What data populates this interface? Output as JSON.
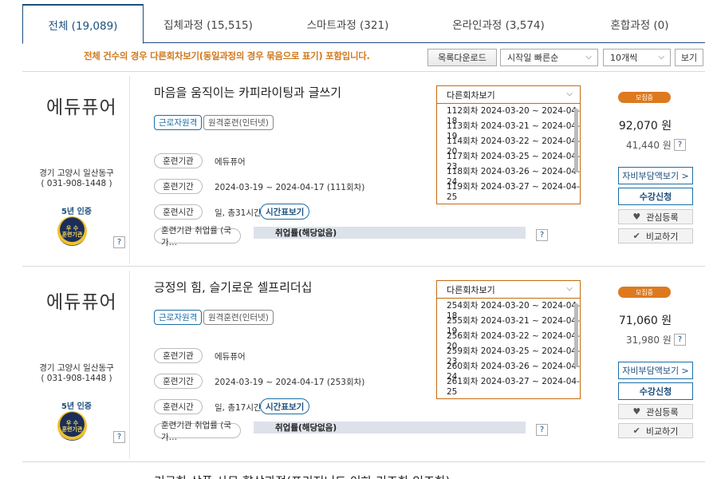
{
  "tabs": [
    {
      "label": "전체 (19,089)"
    },
    {
      "label": "집체과정 (15,515)"
    },
    {
      "label": "스마트과정 (321)"
    },
    {
      "label": "온라인과정 (3,574)"
    },
    {
      "label": "혼합과정 (0)"
    }
  ],
  "toolbar": {
    "notice": "전체 건수의 경우 다른회차보기(동일과정의 경우 묶음으로 표기) 포함입니다.",
    "download_label": "목록다운로드",
    "sort_value": "시작일 빠른순",
    "count_value": "10개씩",
    "view_label": "보기"
  },
  "labels": {
    "org": "훈련기관",
    "period": "훈련기간",
    "time": "훈련시간",
    "employment": "훈련기관 취업률 (국가…",
    "timetable": "시간표보기",
    "other_sessions": "다른회차보기",
    "recruiting": "모집중",
    "self_pay": "자비부담액보기 >",
    "apply": "수강신청",
    "favorite": "관심등록",
    "compare": "비교하기",
    "cert_years": "5년 인증",
    "badge_line1": "우 수",
    "badge_line2": "훈련기관",
    "question": "?"
  },
  "courses": [
    {
      "org_logo": "에듀퓨어",
      "address": "경기 고양시 일산동구",
      "phone": "( 031-908-1448 )",
      "title": "마음을 움직이는 카피라이팅과 글쓰기",
      "tag1": "근로자원격",
      "tag2": "원격훈련(인터넷)",
      "org_name": "에듀퓨어",
      "period": "2024-03-19 ~ 2024-04-17 (111회차)",
      "hours": "일, 총31시간",
      "employment": "취업률(해당없음)",
      "price": "92,070 원",
      "self_price": "41,440 원",
      "sessions": [
        "112회차 2024-03-20 ~ 2024-04-18",
        "113회차 2024-03-21 ~ 2024-04-19",
        "114회차 2024-03-22 ~ 2024-04-20",
        "117회차 2024-03-25 ~ 2024-04-23",
        "118회차 2024-03-26 ~ 2024-04-24",
        "119회차 2024-03-27 ~ 2024-04-25"
      ]
    },
    {
      "org_logo": "에듀퓨어",
      "address": "경기 고양시 일산동구",
      "phone": "( 031-908-1448 )",
      "title": "긍정의 힘, 슬기로운 셀프리더십",
      "tag1": "근로자원격",
      "tag2": "원격훈련(인터넷)",
      "org_name": "에듀퓨어",
      "period": "2024-03-19 ~ 2024-04-17 (253회차)",
      "hours": "일, 총17시간",
      "employment": "취업률(해당없음)",
      "price": "71,060 원",
      "self_price": "31,980 원",
      "sessions": [
        "254회차 2024-03-20 ~ 2024-04-18",
        "255회차 2024-03-21 ~ 2024-04-19",
        "256회차 2024-03-22 ~ 2024-04-20",
        "259회차 2024-03-25 ~ 2024-04-23",
        "260회차 2024-03-26 ~ 2024-04-24",
        "261회차 2024-03-27 ~ 2024-04-25"
      ]
    }
  ],
  "next_course_partial_title": "기근한 상품 사무 향상과정(프리저너드 이하 기조한 인조한)",
  "colors": {
    "primary": "#1b4e7e",
    "accent_orange": "#dd7a1f",
    "notice_orange": "#d07a1e",
    "bar_gray": "#dde1ea"
  }
}
